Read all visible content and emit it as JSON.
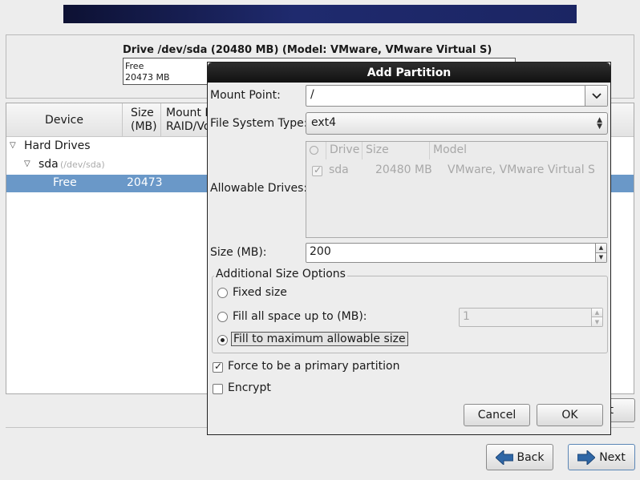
{
  "drive": {
    "title": "Drive /dev/sda (20480 MB) (Model: VMware, VMware Virtual S)",
    "bar_label1": "Free",
    "bar_label2": "20473 MB"
  },
  "tree": {
    "columns": {
      "device": "Device",
      "size_l1": "Size",
      "size_l2": "(MB)",
      "mount_l1": "Mount P",
      "mount_l2": "RAID/Vo"
    },
    "rows": [
      {
        "name": "Hard Drives"
      },
      {
        "name": "sda",
        "path": "(/dev/sda)"
      },
      {
        "name": "Free",
        "size": "20473"
      }
    ]
  },
  "dialog": {
    "title": "Add Partition",
    "mount_point_label": "Mount Point:",
    "mount_point_value": "/",
    "fs_type_label": "File System Type:",
    "fs_type_value": "ext4",
    "allowable_drives_label": "Allowable Drives:",
    "drives_columns": {
      "drive": "Drive",
      "size": "Size",
      "model": "Model"
    },
    "drives": [
      {
        "drive": "sda",
        "size": "20480 MB",
        "model": "VMware, VMware Virtual S",
        "checked": true
      }
    ],
    "size_label": "Size (MB):",
    "size_value": "200",
    "additional_title": "Additional Size Options",
    "opt_fixed": "Fixed size",
    "opt_fill_upto": "Fill all space up to (MB):",
    "fill_upto_value": "1",
    "opt_fill_max": "Fill to maximum allowable size",
    "selected_option": "fill_max",
    "force_primary_label": "Force to be a primary partition",
    "force_primary_checked": true,
    "encrypt_label": "Encrypt",
    "encrypt_checked": false,
    "cancel_label": "Cancel",
    "ok_label": "OK"
  },
  "nav": {
    "hidden_button_fragment": "t",
    "back_label": "Back",
    "next_label": "Next"
  },
  "colors": {
    "selection": "#6a98c8",
    "banner": "#1b2563",
    "arrow": "#2f67a6"
  }
}
